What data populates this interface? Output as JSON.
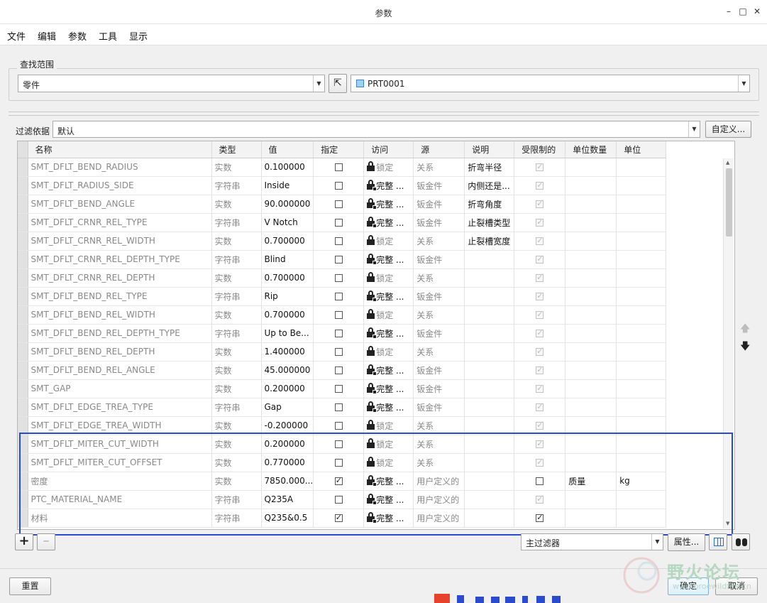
{
  "window": {
    "title": "参数"
  },
  "menu": [
    "文件",
    "编辑",
    "参数",
    "工具",
    "显示"
  ],
  "scope": {
    "legend": "查找范围",
    "type_value": "零件",
    "model_value": "PRT0001"
  },
  "filter": {
    "label": "过滤依据",
    "value": "默认",
    "customize_label": "自定义..."
  },
  "table": {
    "columns": [
      "名称",
      "类型",
      "值",
      "指定",
      "访问",
      "源",
      "说明",
      "受限制的",
      "单位数量",
      "单位"
    ],
    "rows": [
      {
        "name": "SMT_DFLT_BEND_RADIUS",
        "type": "实数",
        "value": "0.100000",
        "designate": false,
        "access": "锁定",
        "source": "关系",
        "desc": "折弯半径",
        "restricted": true,
        "restricted_enabled": false,
        "unit_qty": "",
        "unit": ""
      },
      {
        "name": "SMT_DFLT_RADIUS_SIDE",
        "type": "字符串",
        "value": "Inside",
        "designate": false,
        "access": "完整",
        "source": "钣金件",
        "desc": "内侧还是...",
        "restricted": true,
        "restricted_enabled": false,
        "unit_qty": "",
        "unit": ""
      },
      {
        "name": "SMT_DFLT_BEND_ANGLE",
        "type": "实数",
        "value": "90.000000",
        "designate": false,
        "access": "完整",
        "source": "钣金件",
        "desc": "折弯角度",
        "restricted": true,
        "restricted_enabled": false,
        "unit_qty": "",
        "unit": ""
      },
      {
        "name": "SMT_DFLT_CRNR_REL_TYPE",
        "type": "字符串",
        "value": "V Notch",
        "designate": false,
        "access": "完整",
        "source": "钣金件",
        "desc": "止裂槽类型",
        "restricted": true,
        "restricted_enabled": false,
        "unit_qty": "",
        "unit": ""
      },
      {
        "name": "SMT_DFLT_CRNR_REL_WIDTH",
        "type": "实数",
        "value": "0.700000",
        "designate": false,
        "access": "锁定",
        "source": "关系",
        "desc": "止裂槽宽度",
        "restricted": true,
        "restricted_enabled": false,
        "unit_qty": "",
        "unit": ""
      },
      {
        "name": "SMT_DFLT_CRNR_REL_DEPTH_TYPE",
        "type": "字符串",
        "value": "Blind",
        "designate": false,
        "access": "完整",
        "source": "钣金件",
        "desc": "",
        "restricted": true,
        "restricted_enabled": false,
        "unit_qty": "",
        "unit": ""
      },
      {
        "name": "SMT_DFLT_CRNR_REL_DEPTH",
        "type": "实数",
        "value": "0.700000",
        "designate": false,
        "access": "锁定",
        "source": "关系",
        "desc": "",
        "restricted": true,
        "restricted_enabled": false,
        "unit_qty": "",
        "unit": ""
      },
      {
        "name": "SMT_DFLT_BEND_REL_TYPE",
        "type": "字符串",
        "value": "Rip",
        "designate": false,
        "access": "完整",
        "source": "钣金件",
        "desc": "",
        "restricted": true,
        "restricted_enabled": false,
        "unit_qty": "",
        "unit": ""
      },
      {
        "name": "SMT_DFLT_BEND_REL_WIDTH",
        "type": "实数",
        "value": "0.700000",
        "designate": false,
        "access": "锁定",
        "source": "关系",
        "desc": "",
        "restricted": true,
        "restricted_enabled": false,
        "unit_qty": "",
        "unit": ""
      },
      {
        "name": "SMT_DFLT_BEND_REL_DEPTH_TYPE",
        "type": "字符串",
        "value": "Up to Be...",
        "designate": false,
        "access": "完整",
        "source": "钣金件",
        "desc": "",
        "restricted": true,
        "restricted_enabled": false,
        "unit_qty": "",
        "unit": ""
      },
      {
        "name": "SMT_DFLT_BEND_REL_DEPTH",
        "type": "实数",
        "value": "1.400000",
        "designate": false,
        "access": "锁定",
        "source": "关系",
        "desc": "",
        "restricted": true,
        "restricted_enabled": false,
        "unit_qty": "",
        "unit": ""
      },
      {
        "name": "SMT_DFLT_BEND_REL_ANGLE",
        "type": "实数",
        "value": "45.000000",
        "designate": false,
        "access": "完整",
        "source": "钣金件",
        "desc": "",
        "restricted": true,
        "restricted_enabled": false,
        "unit_qty": "",
        "unit": ""
      },
      {
        "name": "SMT_GAP",
        "type": "实数",
        "value": "0.200000",
        "designate": false,
        "access": "完整",
        "source": "钣金件",
        "desc": "",
        "restricted": true,
        "restricted_enabled": false,
        "unit_qty": "",
        "unit": ""
      },
      {
        "name": "SMT_DFLT_EDGE_TREA_TYPE",
        "type": "字符串",
        "value": "Gap",
        "designate": false,
        "access": "完整",
        "source": "钣金件",
        "desc": "",
        "restricted": true,
        "restricted_enabled": false,
        "unit_qty": "",
        "unit": ""
      },
      {
        "name": "SMT_DFLT_EDGE_TREA_WIDTH",
        "type": "实数",
        "value": "-0.200000",
        "designate": false,
        "access": "锁定",
        "source": "关系",
        "desc": "",
        "restricted": true,
        "restricted_enabled": false,
        "unit_qty": "",
        "unit": ""
      },
      {
        "name": "SMT_DFLT_MITER_CUT_WIDTH",
        "type": "实数",
        "value": "0.200000",
        "designate": false,
        "access": "锁定",
        "source": "关系",
        "desc": "",
        "restricted": true,
        "restricted_enabled": false,
        "unit_qty": "",
        "unit": ""
      },
      {
        "name": "SMT_DFLT_MITER_CUT_OFFSET",
        "type": "实数",
        "value": "0.770000",
        "designate": false,
        "access": "锁定",
        "source": "关系",
        "desc": "",
        "restricted": true,
        "restricted_enabled": false,
        "unit_qty": "",
        "unit": ""
      },
      {
        "name": "密度",
        "type": "实数",
        "value": "7850.000...",
        "designate": true,
        "access": "完整",
        "source": "用户定义的",
        "desc": "",
        "restricted": false,
        "restricted_enabled": true,
        "unit_qty": "质量",
        "unit": "kg"
      },
      {
        "name": "PTC_MATERIAL_NAME",
        "type": "字符串",
        "value": "Q235A",
        "designate": false,
        "access": "完整",
        "source": "用户定义的",
        "desc": "",
        "restricted": true,
        "restricted_enabled": false,
        "unit_qty": "",
        "unit": ""
      },
      {
        "name": "材料",
        "type": "字符串",
        "value": "Q235&0.5",
        "designate": true,
        "access": "完整",
        "source": "用户定义的",
        "desc": "",
        "restricted": true,
        "restricted_enabled": true,
        "unit_qty": "",
        "unit": ""
      }
    ]
  },
  "bottom": {
    "main_filter_value": "主过滤器",
    "properties_label": "属性...",
    "reset_label": "重置",
    "ok_label": "确定",
    "cancel_label": "取消"
  },
  "watermark": {
    "text": "野火论坛",
    "url": "www.proewildfire.cn"
  },
  "colors": {
    "highlight_border": "#2a4bd0",
    "watermark": "#b4d7c0"
  }
}
